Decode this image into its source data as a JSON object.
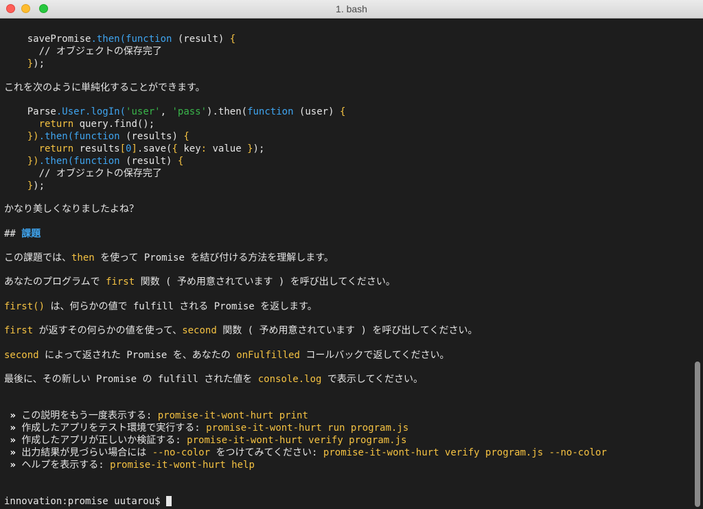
{
  "window": {
    "title": "1. bash"
  },
  "terminal": {
    "code1": {
      "l1_a": "savePromise",
      "l1_b": ".then(",
      "l1_c": "function",
      "l1_d": " (result) ",
      "l1_e": "{",
      "l2": "  // オブジェクトの保存完了",
      "l3_a": "}",
      "l3_b": ");"
    },
    "para1": "これを次のように単純化することができます。",
    "code2": {
      "l1_a": "Parse",
      "l1_b": ".User.logIn(",
      "l1_c": "'user'",
      "l1_d": ", ",
      "l1_e": "'pass'",
      "l1_f": ").then(",
      "l1_g": "function",
      "l1_h": " (user) ",
      "l1_i": "{",
      "l2_a": "  return",
      "l2_b": " query.find();",
      "l3_a": "})",
      "l3_b": ".then(",
      "l3_c": "function",
      "l3_d": " (results) ",
      "l3_e": "{",
      "l4_a": "  return",
      "l4_b": " results",
      "l4_c": "[",
      "l4_d": "0",
      "l4_e": "]",
      "l4_f": ".save(",
      "l4_g": "{",
      "l4_h": " key",
      "l4_i": ":",
      "l4_j": " value ",
      "l4_k": "}",
      "l4_l": ");",
      "l5_a": "})",
      "l5_b": ".then(",
      "l5_c": "function",
      "l5_d": " (result) ",
      "l5_e": "{",
      "l6": "  // オブジェクトの保存完了",
      "l7_a": "}",
      "l7_b": ");"
    },
    "para2": "かなり美しくなりましたよね？",
    "heading_hash": "## ",
    "heading_text": "課題",
    "p3": {
      "a": "この課題では、",
      "b": "then",
      "c": " を使って Promise を結び付ける方法を理解します。"
    },
    "p4": {
      "a": "あなたのプログラムで ",
      "b": "first",
      "c": " 関数 ( 予め用意されています ) を呼び出してください。"
    },
    "p5": {
      "a": "first()",
      "b": " は、何らかの値で fulfill される Promise を返します。"
    },
    "p6": {
      "a": "first",
      "b": " が返すその何らかの値を使って、",
      "c": "second",
      "d": " 関数 ( 予め用意されています ) を呼び出してください。"
    },
    "p7": {
      "a": "second",
      "b": " によって返された Promise を、あなたの ",
      "c": "onFulfilled",
      "d": " コールバックで返してください。"
    },
    "p8": {
      "a": "最後に、その新しい Promise の fulfill された値を ",
      "b": "console.log",
      "c": " で表示してください。"
    },
    "bullet_char": "»",
    "menu": [
      {
        "label": "この説明をもう一度表示する: ",
        "command": "promise-it-wont-hurt print"
      },
      {
        "label": "作成したアプリをテスト環境で実行する: ",
        "command": "promise-it-wont-hurt run program.js"
      },
      {
        "label": "作成したアプリが正しいか検証する: ",
        "command": "promise-it-wont-hurt verify program.js"
      },
      {
        "label": "出力結果が見づらい場合には ",
        "flag": "--no-color",
        "label2": " をつけてみてください: ",
        "command": "promise-it-wont-hurt verify program.js --no-color"
      },
      {
        "label": "ヘルプを表示する: ",
        "command": "promise-it-wont-hurt help"
      }
    ],
    "prompt": "innovation:promise uutarou$ "
  }
}
